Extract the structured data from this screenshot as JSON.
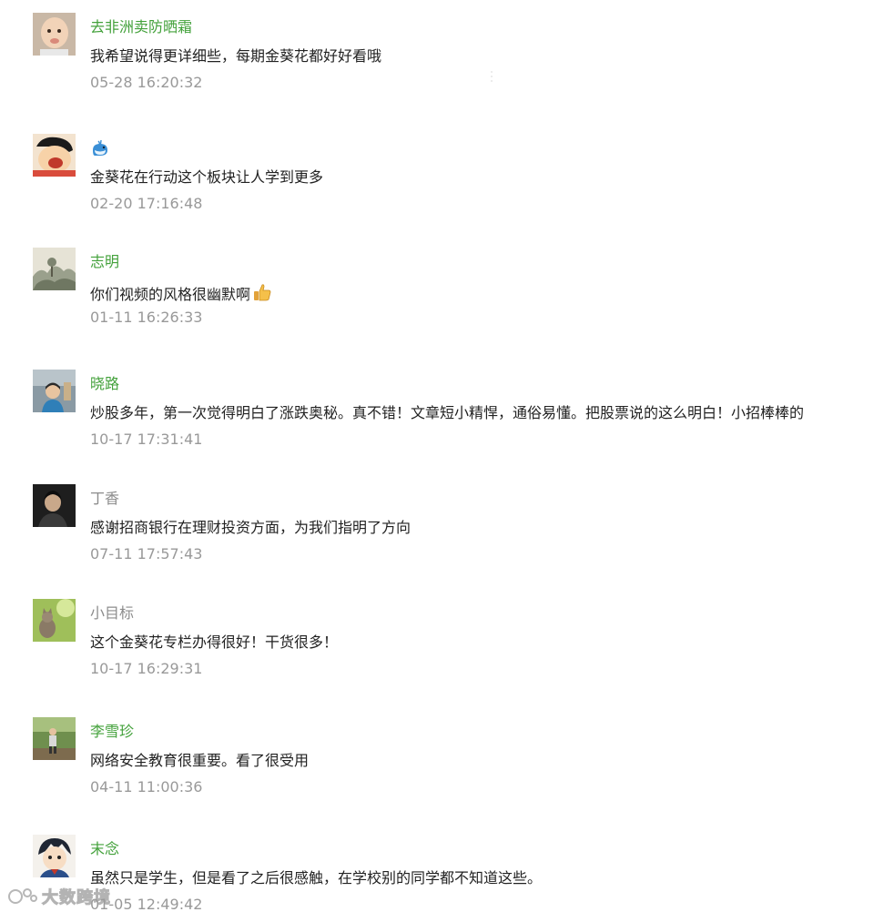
{
  "comments": [
    {
      "name": "去非洲卖防晒霜",
      "name_color": "green",
      "avatar": "baby-avatar",
      "text": "我希望说得更详细些，每期金葵花都好好看哦",
      "time": "05-28 16:20:32"
    },
    {
      "name": "",
      "name_icon": "blue-whale-emoji",
      "name_color": "green",
      "avatar": "cartoon-boy-avatar",
      "text": "金葵花在行动这个板块让人学到更多",
      "time": "02-20 17:16:48"
    },
    {
      "name": "志明",
      "name_color": "green",
      "avatar": "landscape-painting-avatar",
      "text": "你们视频的风格很幽默啊",
      "text_icon": "thumbs-up-emoji",
      "time": "01-11 16:26:33"
    },
    {
      "name": "晓路",
      "name_color": "green",
      "avatar": "person-photo-avatar",
      "text": "炒股多年，第一次觉得明白了涨跌奥秘。真不错！文章短小精悍，通俗易懂。把股票说的这么明白！小招棒棒的",
      "time": "10-17 17:31:41"
    },
    {
      "name": "丁香",
      "name_color": "gray",
      "avatar": "dark-portrait-avatar",
      "text": "感谢招商银行在理财投资方面，为我们指明了方向",
      "time": "07-11 17:57:43"
    },
    {
      "name": "小目标",
      "name_color": "gray",
      "avatar": "cat-avatar",
      "text": "这个金葵花专栏办得很好！干货很多！",
      "time": "10-17 16:29:31"
    },
    {
      "name": "李雪珍",
      "name_color": "green",
      "avatar": "outdoor-photo-avatar",
      "text": "网络安全教育很重要。看了很受用",
      "time": "04-11 11:00:36"
    },
    {
      "name": "末念",
      "name_color": "green",
      "avatar": "anime-boy-avatar",
      "text": "虽然只是学生，但是看了之后很感触，在学校别的同学都不知道这些。",
      "time": "01-05 12:49:42"
    }
  ],
  "watermark": {
    "text": "大数跨境",
    "icon": "logo-icon"
  }
}
